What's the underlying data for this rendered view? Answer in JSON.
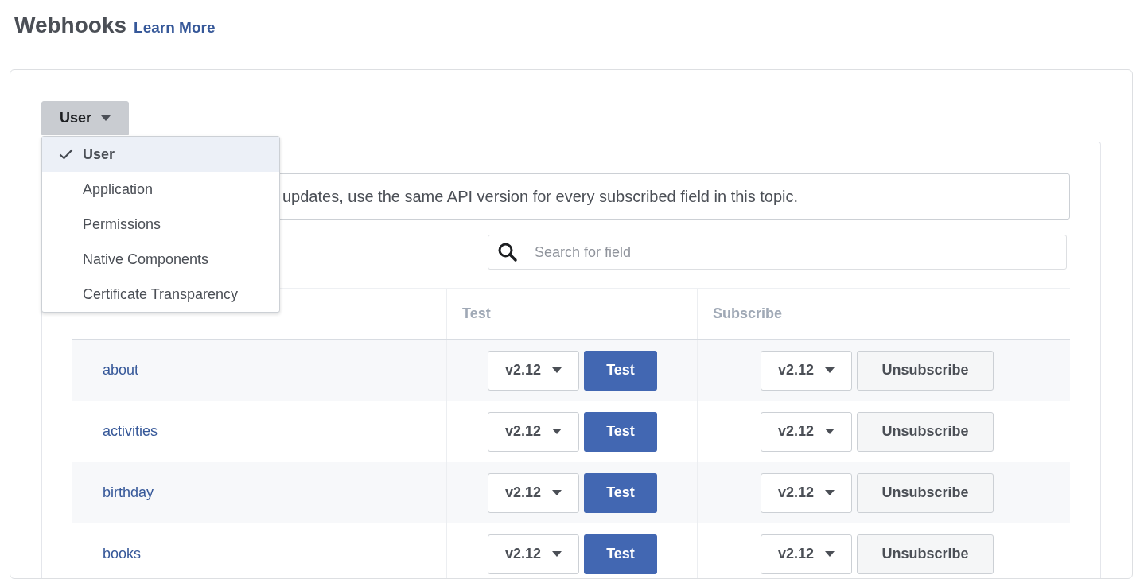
{
  "header": {
    "title": "Webhooks",
    "link": "Learn More"
  },
  "topic_dropdown": {
    "label": "User",
    "expanded": true
  },
  "topic_menu": [
    {
      "label": "User",
      "selected": true
    },
    {
      "label": "Application",
      "selected": false
    },
    {
      "label": "Permissions",
      "selected": false
    },
    {
      "label": "Native Components",
      "selected": false
    },
    {
      "label": "Certificate Transparency",
      "selected": false
    }
  ],
  "notice": "updates, use the same API version for every subscribed field in this topic.",
  "search": {
    "placeholder": "Search for field"
  },
  "table": {
    "columns": [
      "Test",
      "Subscribe"
    ],
    "rows": [
      {
        "name": "about",
        "test_version": "v2.12",
        "test_button": "Test",
        "subscribe_version": "v2.12",
        "subscribe_button": "Unsubscribe"
      },
      {
        "name": "activities",
        "test_version": "v2.12",
        "test_button": "Test",
        "subscribe_version": "v2.12",
        "subscribe_button": "Unsubscribe"
      },
      {
        "name": "birthday",
        "test_version": "v2.12",
        "test_button": "Test",
        "subscribe_version": "v2.12",
        "subscribe_button": "Unsubscribe"
      },
      {
        "name": "books",
        "test_version": "v2.12",
        "test_button": "Test",
        "subscribe_version": "v2.12",
        "subscribe_button": "Unsubscribe"
      }
    ]
  }
}
